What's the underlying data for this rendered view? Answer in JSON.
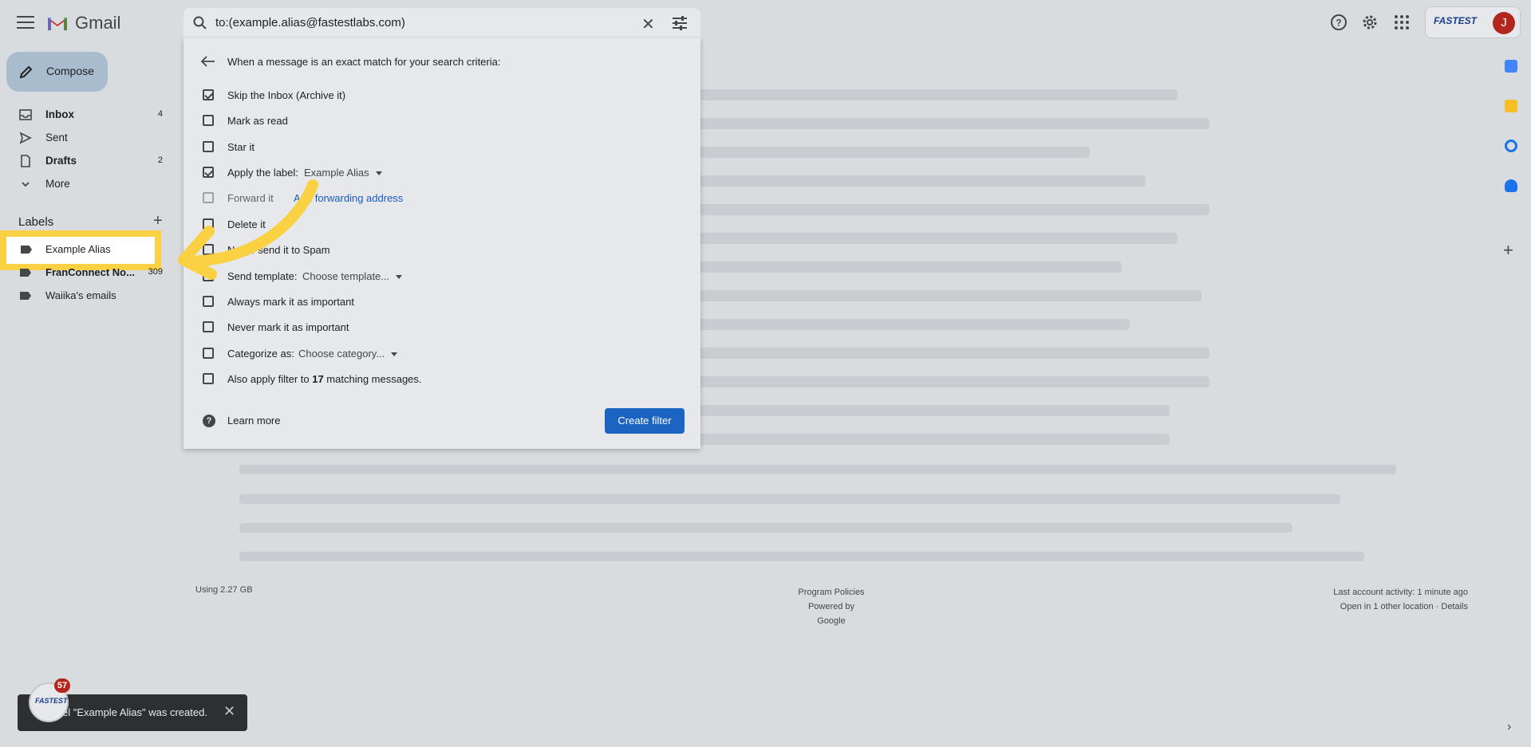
{
  "app": {
    "name": "Gmail"
  },
  "search": {
    "query": "to:(example.alias@fastestlabs.com)"
  },
  "account": {
    "logo": "FASTEST",
    "avatar_initial": "J"
  },
  "sidebar": {
    "compose": "Compose",
    "nav": [
      {
        "label": "Inbox",
        "count": "4",
        "bold": true
      },
      {
        "label": "Sent",
        "count": ""
      },
      {
        "label": "Drafts",
        "count": "2",
        "bold": true
      },
      {
        "label": "More",
        "count": ""
      }
    ],
    "labels_title": "Labels",
    "labels": [
      {
        "label": "Example Alias",
        "count": ""
      },
      {
        "label": "FranConnect No...",
        "count": "309"
      },
      {
        "label": "Waiika's emails",
        "count": ""
      }
    ]
  },
  "filter": {
    "heading": "When a message is an exact match for your search criteria:",
    "options": [
      {
        "label": "Skip the Inbox (Archive it)",
        "checked": true
      },
      {
        "label": "Mark as read",
        "checked": false
      },
      {
        "label": "Star it",
        "checked": false
      },
      {
        "label": "Apply the label:",
        "checked": true,
        "select": "Example Alias"
      },
      {
        "label": "Forward it",
        "checked": false,
        "disabled": true,
        "link": "Add forwarding address"
      },
      {
        "label": "Delete it",
        "checked": false
      },
      {
        "label": "Never send it to Spam",
        "checked": false
      },
      {
        "label": "Send template:",
        "checked": false,
        "select": "Choose template..."
      },
      {
        "label": "Always mark it as important",
        "checked": false
      },
      {
        "label": "Never mark it as important",
        "checked": false
      },
      {
        "label": "Categorize as:",
        "checked": false,
        "select": "Choose category..."
      },
      {
        "label_prefix": "Also apply filter to ",
        "label_count": "17",
        "label_suffix": " matching messages.",
        "checked": false
      }
    ],
    "learn_more": "Learn more",
    "create": "Create filter"
  },
  "footer": {
    "storage": "Using 2.27 GB",
    "policies": "Program Policies",
    "powered": "Powered by Google",
    "activity": "Last account activity: 1 minute ago",
    "location": "Open in 1 other location · Details"
  },
  "toast": {
    "text": "Label \"Example Alias\" was created.",
    "visible_text": "el \"Example Alias\" was created."
  },
  "bubble": {
    "logo": "FASTEST",
    "count": "57"
  },
  "colors": {
    "highlight": "#f9d143",
    "primary": "#1b64c2",
    "avatar": "#b3261e"
  }
}
